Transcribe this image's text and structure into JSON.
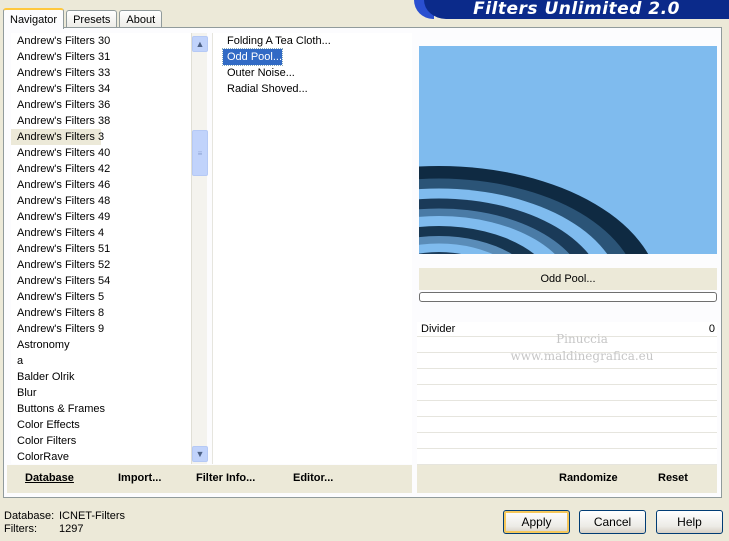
{
  "banner": "Filters Unlimited 2.0",
  "tabs": [
    {
      "label": "Navigator"
    },
    {
      "label": "Presets"
    },
    {
      "label": "About"
    }
  ],
  "categories": [
    "Andrew's Filters 30",
    "Andrew's Filters 31",
    "Andrew's Filters 33",
    "Andrew's Filters 34",
    "Andrew's Filters 36",
    "Andrew's Filters 38",
    "Andrew's Filters 3",
    "Andrew's Filters 40",
    "Andrew's Filters 42",
    "Andrew's Filters 46",
    "Andrew's Filters 48",
    "Andrew's Filters 49",
    "Andrew's Filters 4",
    "Andrew's Filters 51",
    "Andrew's Filters 52",
    "Andrew's Filters 54",
    "Andrew's Filters 5",
    "Andrew's Filters 8",
    "Andrew's Filters 9",
    "Astronomy",
    "a",
    "Balder Olrik",
    "Blur",
    "Buttons & Frames",
    "Color Effects",
    "Color Filters",
    "ColorRave"
  ],
  "selected_category": "Andrew's Filters 3",
  "filters": [
    "Folding A Tea Cloth...",
    "Odd Pool...",
    "Outer Noise...",
    "Radial Shoved..."
  ],
  "selected_filter": "Odd Pool...",
  "preview_title": "Odd Pool...",
  "controls": [
    {
      "label": "Divider",
      "value": "0"
    }
  ],
  "watermark": {
    "line1": "Pinuccia",
    "line2": "www.maldinegrafica.eu"
  },
  "bottom_left": {
    "database": "Database",
    "import": "Import...",
    "filter_info": "Filter Info...",
    "editor": "Editor..."
  },
  "bottom_right": {
    "randomize": "Randomize",
    "reset": "Reset"
  },
  "footer": {
    "database_label": "Database:",
    "database_value": "ICNET-Filters",
    "filters_label": "Filters:",
    "filters_value": "1297"
  },
  "buttons": {
    "apply": "Apply",
    "cancel": "Cancel",
    "help": "Help"
  }
}
